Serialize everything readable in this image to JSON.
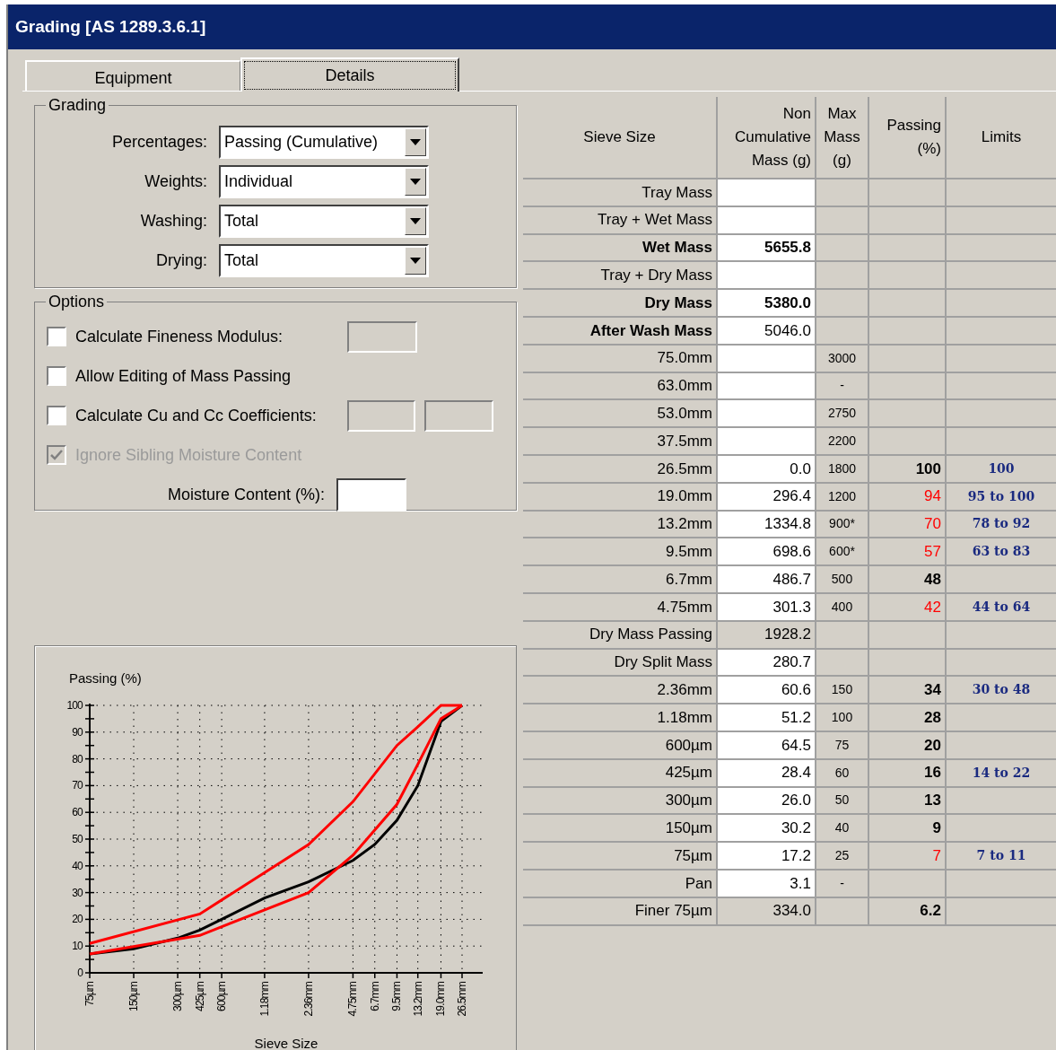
{
  "window": {
    "title": "Grading [AS 1289.3.6.1]"
  },
  "tabs": [
    {
      "label": "Equipment",
      "selected": false
    },
    {
      "label": "Details",
      "selected": true
    }
  ],
  "grading": {
    "title": "Grading",
    "fields": [
      {
        "label": "Percentages:",
        "value": "Passing (Cumulative)"
      },
      {
        "label": "Weights:",
        "value": "Individual"
      },
      {
        "label": "Washing:",
        "value": "Total"
      },
      {
        "label": "Drying:",
        "value": "Total"
      }
    ]
  },
  "options": {
    "title": "Options",
    "items": [
      {
        "kind": "checkbox_field",
        "label": "Calculate Fineness Modulus:",
        "checked": false,
        "disabled": false
      },
      {
        "kind": "checkbox",
        "label": "Allow Editing of Mass Passing",
        "checked": false,
        "disabled": false
      },
      {
        "kind": "checkbox_two_fields",
        "label": "Calculate Cu and Cc Coefficients:",
        "checked": false,
        "disabled": false
      },
      {
        "kind": "checkbox",
        "label": "Ignore Sibling Moisture Content",
        "checked": true,
        "disabled": true
      },
      {
        "kind": "field",
        "label": "Moisture Content (%):"
      }
    ]
  },
  "chart": {
    "chart_data": {
      "type": "line",
      "ylabel": "Passing (%)",
      "xlabel": "Sieve Size",
      "categories": [
        "75µm",
        "150µm",
        "300µm",
        "425µm",
        "600µm",
        "1.18mm",
        "2.36mm",
        "4.75mm",
        "6.7mm",
        "9.5mm",
        "13.2mm",
        "19.0mm",
        "26.5mm"
      ],
      "ylim": [
        0,
        100
      ],
      "grid": true,
      "yticks": [
        0,
        10,
        20,
        30,
        40,
        50,
        60,
        70,
        80,
        90,
        100
      ],
      "series": [
        {
          "color": "#000000",
          "values": [
            7,
            9,
            13,
            16,
            20,
            28,
            34,
            42,
            48,
            57,
            70,
            94,
            100
          ]
        },
        {
          "color": "#ff0000",
          "values": [
            7,
            null,
            null,
            14,
            null,
            null,
            30,
            44,
            null,
            63,
            78,
            95,
            100
          ]
        },
        {
          "color": "#ff0000",
          "values": [
            11,
            null,
            null,
            22,
            null,
            null,
            48,
            64,
            null,
            85,
            92,
            100,
            100
          ]
        }
      ]
    }
  },
  "table": {
    "columns": [
      "Sieve Size",
      "Non Cumulative Mass (g)",
      "Max Mass (g)",
      "Passing (%)",
      "Limits"
    ],
    "rows": [
      {
        "label": "Tray Mass",
        "bold": false,
        "mass_bold": false,
        "editable": true
      },
      {
        "label": "Tray + Wet Mass",
        "bold": false,
        "mass_bold": false,
        "editable": true
      },
      {
        "label": "Wet Mass",
        "bold": true,
        "mass": "5655.8",
        "mass_bold": true,
        "editable": true
      },
      {
        "label": "Tray + Dry Mass",
        "bold": false,
        "mass_bold": false,
        "editable": true
      },
      {
        "label": "Dry Mass",
        "bold": true,
        "mass": "5380.0",
        "mass_bold": true,
        "editable": true
      },
      {
        "label": "After Wash Mass",
        "bold": true,
        "mass": "5046.0",
        "mass_bold": false,
        "editable": true
      },
      {
        "label": "75.0mm",
        "bold": false,
        "mass_bold": false,
        "editable": true,
        "max_mass": "3000"
      },
      {
        "label": "63.0mm",
        "bold": false,
        "mass_bold": false,
        "editable": true,
        "max_mass": "-"
      },
      {
        "label": "53.0mm",
        "bold": false,
        "mass_bold": false,
        "editable": true,
        "max_mass": "2750"
      },
      {
        "label": "37.5mm",
        "bold": false,
        "mass_bold": false,
        "editable": true,
        "max_mass": "2200"
      },
      {
        "label": "26.5mm",
        "bold": false,
        "mass": "0.0",
        "mass_bold": false,
        "editable": true,
        "max_mass": "1800",
        "passing": "100",
        "out_of_limits": false,
        "limits": "100"
      },
      {
        "label": "19.0mm",
        "bold": false,
        "mass": "296.4",
        "mass_bold": false,
        "editable": true,
        "max_mass": "1200",
        "passing": "94",
        "out_of_limits": true,
        "limits": "95 to 100"
      },
      {
        "label": "13.2mm",
        "bold": false,
        "mass": "1334.8",
        "mass_bold": false,
        "editable": true,
        "max_mass": "900*",
        "passing": "70",
        "out_of_limits": true,
        "limits": "78 to 92"
      },
      {
        "label": "9.5mm",
        "bold": false,
        "mass": "698.6",
        "mass_bold": false,
        "editable": true,
        "max_mass": "600*",
        "passing": "57",
        "out_of_limits": true,
        "limits": "63 to 83"
      },
      {
        "label": "6.7mm",
        "bold": false,
        "mass": "486.7",
        "mass_bold": false,
        "editable": true,
        "max_mass": "500",
        "passing": "48",
        "out_of_limits": false
      },
      {
        "label": "4.75mm",
        "bold": false,
        "mass": "301.3",
        "mass_bold": false,
        "editable": true,
        "max_mass": "400",
        "passing": "42",
        "out_of_limits": true,
        "limits": "44 to 64"
      },
      {
        "label": "Dry Mass Passing",
        "bold": false,
        "mass": "1928.2",
        "mass_bold": false,
        "editable": false
      },
      {
        "label": "Dry Split Mass",
        "bold": false,
        "mass": "280.7",
        "mass_bold": false,
        "editable": true
      },
      {
        "label": "2.36mm",
        "bold": false,
        "mass": "60.6",
        "mass_bold": false,
        "editable": true,
        "max_mass": "150",
        "passing": "34",
        "out_of_limits": false,
        "limits": "30 to 48"
      },
      {
        "label": "1.18mm",
        "bold": false,
        "mass": "51.2",
        "mass_bold": false,
        "editable": true,
        "max_mass": "100",
        "passing": "28",
        "out_of_limits": false
      },
      {
        "label": "600µm",
        "bold": false,
        "mass": "64.5",
        "mass_bold": false,
        "editable": true,
        "max_mass": "75",
        "passing": "20",
        "out_of_limits": false
      },
      {
        "label": "425µm",
        "bold": false,
        "mass": "28.4",
        "mass_bold": false,
        "editable": true,
        "max_mass": "60",
        "passing": "16",
        "out_of_limits": false,
        "limits": "14 to 22"
      },
      {
        "label": "300µm",
        "bold": false,
        "mass": "26.0",
        "mass_bold": false,
        "editable": true,
        "max_mass": "50",
        "passing": "13",
        "out_of_limits": false
      },
      {
        "label": "150µm",
        "bold": false,
        "mass": "30.2",
        "mass_bold": false,
        "editable": true,
        "max_mass": "40",
        "passing": "9",
        "out_of_limits": false
      },
      {
        "label": "75µm",
        "bold": false,
        "mass": "17.2",
        "mass_bold": false,
        "editable": true,
        "max_mass": "25",
        "passing": "7",
        "out_of_limits": true,
        "limits": "7 to 11"
      },
      {
        "label": "Pan",
        "bold": false,
        "mass": "3.1",
        "mass_bold": false,
        "editable": true,
        "max_mass": "-"
      },
      {
        "label": "Finer 75µm",
        "bold": false,
        "mass": "334.0",
        "mass_bold": false,
        "editable": false,
        "passing": "6.2",
        "out_of_limits": false
      }
    ]
  }
}
